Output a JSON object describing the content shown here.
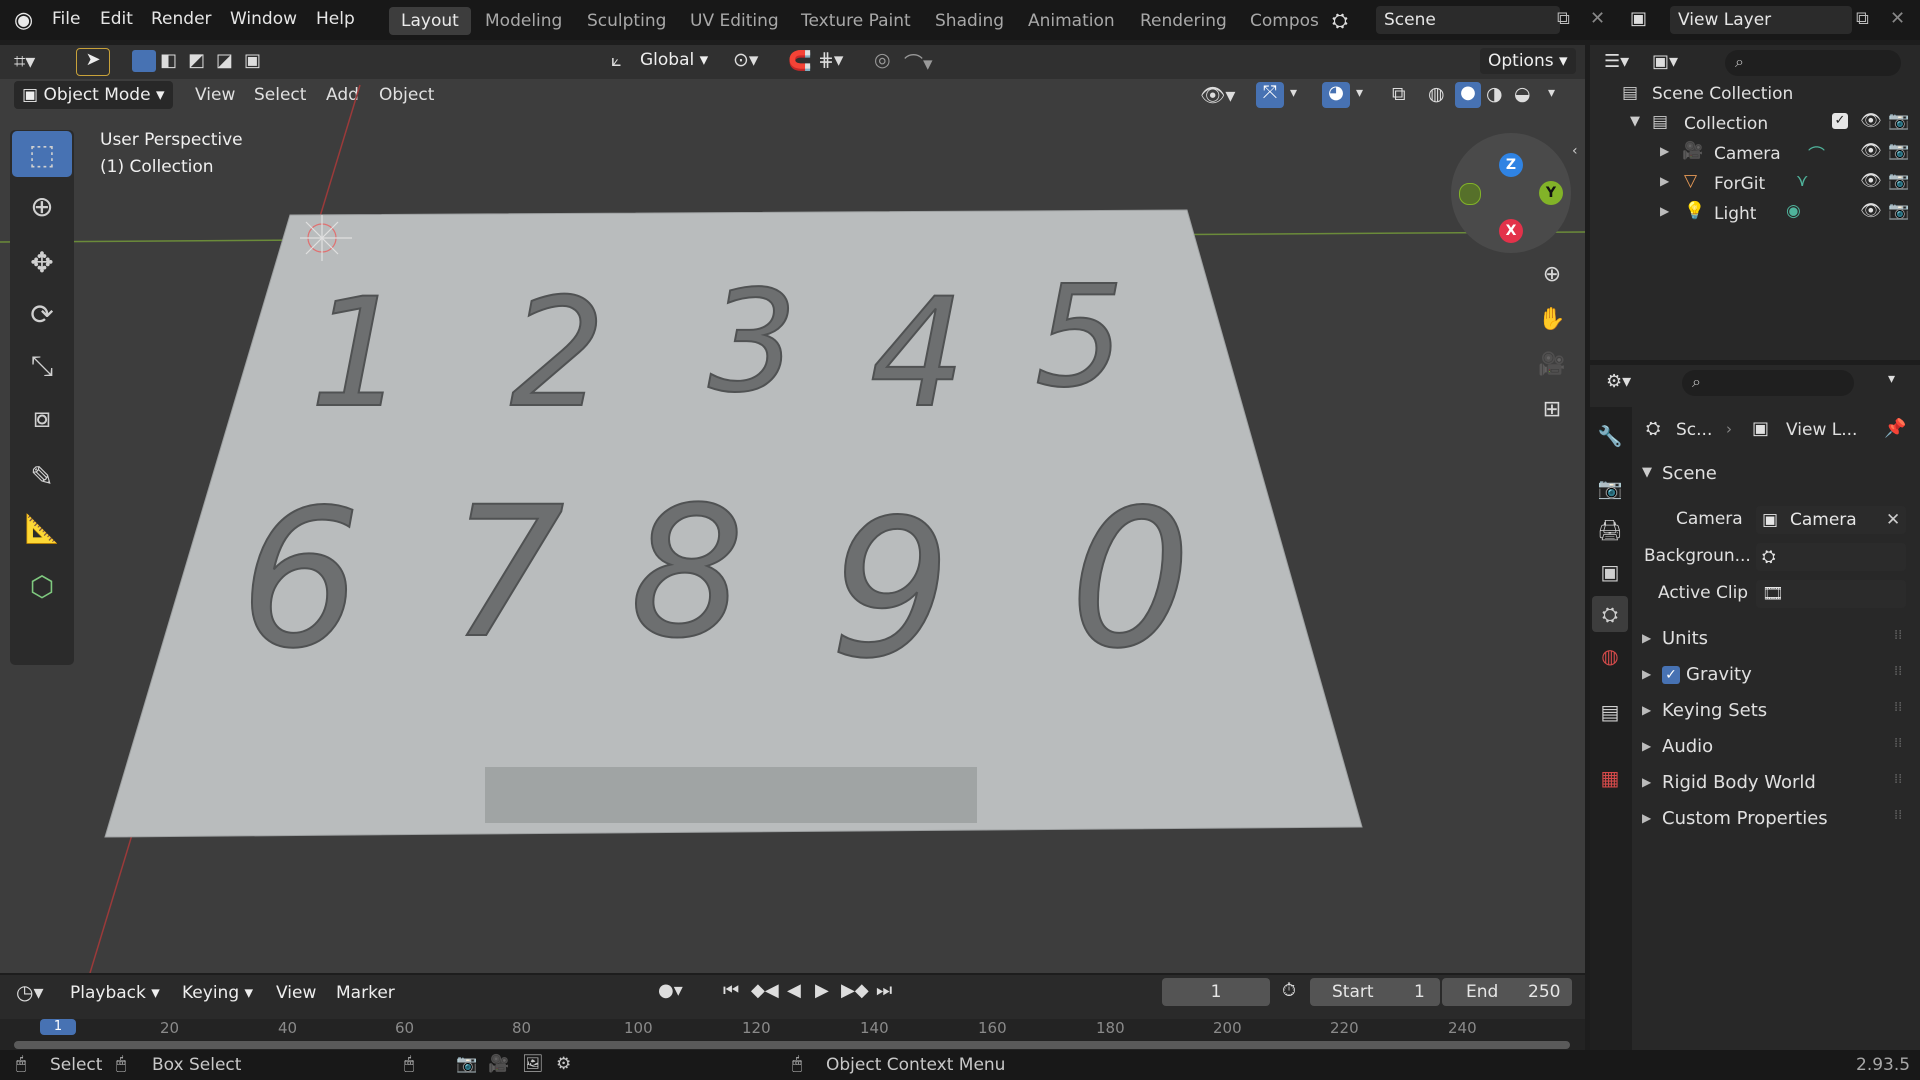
{
  "menubar": {
    "items": [
      "File",
      "Edit",
      "Render",
      "Window",
      "Help"
    ],
    "workspace_tabs": [
      "Layout",
      "Modeling",
      "Sculpting",
      "UV Editing",
      "Texture Paint",
      "Shading",
      "Animation",
      "Rendering",
      "Compos"
    ],
    "active_tab": "Layout",
    "scene_field": "Scene",
    "view_layer_field": "View Layer"
  },
  "viewport": {
    "transform_orientation": "Global",
    "options_label": "Options",
    "mode": "Object Mode",
    "header_menus": [
      "View",
      "Select",
      "Add",
      "Object"
    ],
    "overlay_line1": "User Perspective",
    "overlay_line2": "(1) Collection",
    "gizmo_axes": {
      "z": "Z",
      "y": "Y",
      "x": "X"
    },
    "plane_digits_row1": [
      "1",
      "2",
      "3",
      "4",
      "5"
    ],
    "plane_digits_row2": [
      "6",
      "7",
      "8",
      "9",
      "0"
    ],
    "colors": {
      "plane": "#b9bcbd",
      "bg": "#3d3d3d",
      "active": "#4772b3"
    }
  },
  "outliner": {
    "root": "Scene Collection",
    "collection": "Collection",
    "objects": [
      "Camera",
      "ForGit",
      "Light"
    ]
  },
  "properties": {
    "breadcrumb_scene": "Sc...",
    "breadcrumb_view": "View L...",
    "panel_title": "Scene",
    "camera_label": "Camera",
    "camera_value": "Camera",
    "background_label": "Backgroun...",
    "active_clip_label": "Active Clip",
    "sections": [
      "Units",
      "Gravity",
      "Keying Sets",
      "Audio",
      "Rigid Body World",
      "Custom Properties"
    ],
    "gravity_checked": true
  },
  "timeline": {
    "menus": [
      "Playback",
      "Keying",
      "View",
      "Marker"
    ],
    "current_frame": "1",
    "start_label": "Start",
    "start_value": "1",
    "end_label": "End",
    "end_value": "250",
    "ruler_ticks": [
      "1",
      "20",
      "40",
      "60",
      "80",
      "100",
      "120",
      "140",
      "160",
      "180",
      "200",
      "220",
      "240"
    ]
  },
  "statusbar": {
    "select": "Select",
    "box_select": "Box Select",
    "context_menu": "Object Context Menu",
    "version": "2.93.5"
  }
}
